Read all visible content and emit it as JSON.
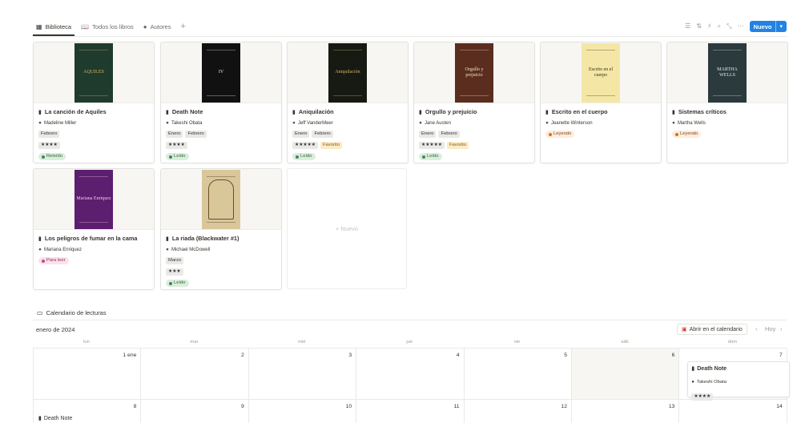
{
  "tabs": [
    {
      "label": "Biblioteca",
      "icon": "grid-icon"
    },
    {
      "label": "Todos los libros",
      "icon": "book-open-icon"
    },
    {
      "label": "Autores",
      "icon": "person-icon"
    }
  ],
  "toolbar": {
    "new_label": "Nuevo"
  },
  "cards": [
    {
      "title": "La canción de Aquiles",
      "author": "Madeline Miller",
      "months": [
        "Febrero"
      ],
      "rating": "★★★★",
      "favorite": "",
      "status": "Releído",
      "status_color": "green",
      "cover_text": "AQUILES",
      "cover_bg": "#1f3b2e",
      "cover_fg": "#d8b45a"
    },
    {
      "title": "Death Note",
      "author": "Takeshi Obata",
      "months": [
        "Enero",
        "Febrero"
      ],
      "rating": "★★★★",
      "favorite": "",
      "status": "Leído",
      "status_color": "green",
      "cover_text": "IV",
      "cover_bg": "#111111",
      "cover_fg": "#e8e8e8"
    },
    {
      "title": "Aniquilación",
      "author": "Jeff VanderMeer",
      "months": [
        "Enero",
        "Febrero"
      ],
      "rating": "★★★★★",
      "favorite": "Favorito",
      "status": "Leído",
      "status_color": "green",
      "cover_text": "Aniquilación",
      "cover_bg": "#161a12",
      "cover_fg": "#d6b46a"
    },
    {
      "title": "Orgullo y prejuicio",
      "author": "Jane Austen",
      "months": [
        "Enero",
        "Febrero"
      ],
      "rating": "★★★★★",
      "favorite": "Favorito",
      "status": "Leído",
      "status_color": "green",
      "cover_text": "Orgullo y prejuicio",
      "cover_bg": "#5a2d1e",
      "cover_fg": "#f1e3c2"
    },
    {
      "title": "Escrito en el cuerpo",
      "author": "Jeanette Winterson",
      "months": [],
      "rating": "",
      "favorite": "",
      "status": "Leyendo",
      "status_color": "orange",
      "cover_text": "Escrito en el cuerpo",
      "cover_bg": "#f4e7a6",
      "cover_fg": "#3b2a12"
    },
    {
      "title": "Sistemas críticos",
      "author": "Martha Wells",
      "months": [],
      "rating": "",
      "favorite": "",
      "status": "Leyendo",
      "status_color": "orange",
      "cover_text": "MARTHA WELLS",
      "cover_bg": "#2b3a3c",
      "cover_fg": "#dfe6e6"
    },
    {
      "title": "Los peligros de fumar en la cama",
      "author": "Mariana Enriquez",
      "months": [],
      "rating": "",
      "favorite": "",
      "status": "Para leer",
      "status_color": "pink",
      "cover_text": "Mariana Enriquez",
      "cover_bg": "#5c1e6e",
      "cover_fg": "#f5c7e8"
    },
    {
      "title": "La riada (Blackwater #1)",
      "author": "Michael McDowell",
      "months": [
        "Marzo"
      ],
      "rating": "★★★",
      "favorite": "",
      "status": "Leído",
      "status_color": "green",
      "cover_text": "",
      "cover_bg": "#d9c79a",
      "cover_fg": "#3b2a12"
    }
  ],
  "new_card_label": "+ Nuevo",
  "calendar": {
    "title": "Calendario de lecturas",
    "month": "enero de 2024",
    "open_label": "Abrir en el calendario",
    "today_label": "Hoy",
    "weekdays": [
      "lun",
      "mar",
      "mié",
      "jue",
      "vie",
      "sáb",
      "dom"
    ],
    "week1": [
      "1 ene",
      "2",
      "3",
      "4",
      "5",
      "6",
      "7"
    ],
    "week2": [
      "8",
      "9",
      "10",
      "11",
      "12",
      "13",
      "14"
    ],
    "event": {
      "title": "Death Note",
      "author": "Takeshi Obata",
      "rating": "★★★★"
    },
    "event2": {
      "title": "Death Note"
    }
  }
}
